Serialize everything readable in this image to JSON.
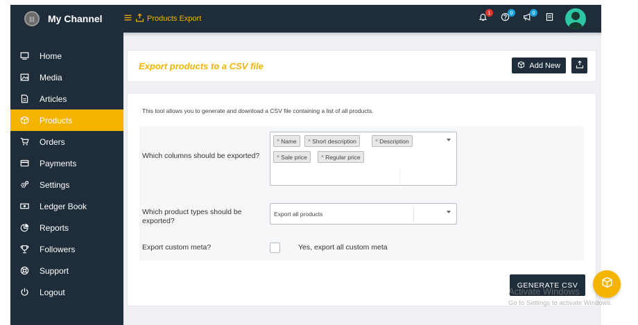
{
  "brand": {
    "name": "My Channel",
    "logo_text": "|||"
  },
  "topbar": {
    "breadcrumb": "Products Export",
    "badges": {
      "notifications": "1",
      "help": "0",
      "announcements": "0"
    }
  },
  "sidebar": {
    "items": [
      {
        "label": "Home",
        "icon": "monitor-icon"
      },
      {
        "label": "Media",
        "icon": "image-icon"
      },
      {
        "label": "Articles",
        "icon": "file-icon"
      },
      {
        "label": "Products",
        "icon": "box-icon",
        "active": true
      },
      {
        "label": "Orders",
        "icon": "cart-icon"
      },
      {
        "label": "Payments",
        "icon": "credit-card-icon"
      },
      {
        "label": "Settings",
        "icon": "gears-icon"
      },
      {
        "label": "Ledger Book",
        "icon": "money-icon"
      },
      {
        "label": "Reports",
        "icon": "pie-chart-icon"
      },
      {
        "label": "Followers",
        "icon": "trophy-icon"
      },
      {
        "label": "Support",
        "icon": "lifebuoy-icon"
      },
      {
        "label": "Logout",
        "icon": "power-icon"
      }
    ]
  },
  "header_card": {
    "title": "Export products to a CSV file",
    "add_new_label": "Add New"
  },
  "export_form": {
    "description": "This tool allows you to generate and download a CSV file containing a list of all products.",
    "columns_label": "Which columns should be exported?",
    "columns_chips": [
      "Name",
      "Short description",
      "Description",
      "Sale price",
      "Regular price"
    ],
    "chip_remove": "×",
    "types_label": "Which product types should be exported?",
    "types_value": "Export all products",
    "meta_label": "Export custom meta?",
    "meta_checkbox_label": "Yes, export all custom meta",
    "meta_checked": false,
    "generate_label": "GENERATE CSV"
  },
  "watermark": {
    "line1": "Activate Windows",
    "line2": "Go to Settings to activate Windows."
  },
  "colors": {
    "accent": "#f5b400",
    "dark": "#1f2d3a",
    "badge_red": "#e0352b",
    "badge_blue": "#1aa0d8",
    "avatar": "#2ec7a4"
  }
}
